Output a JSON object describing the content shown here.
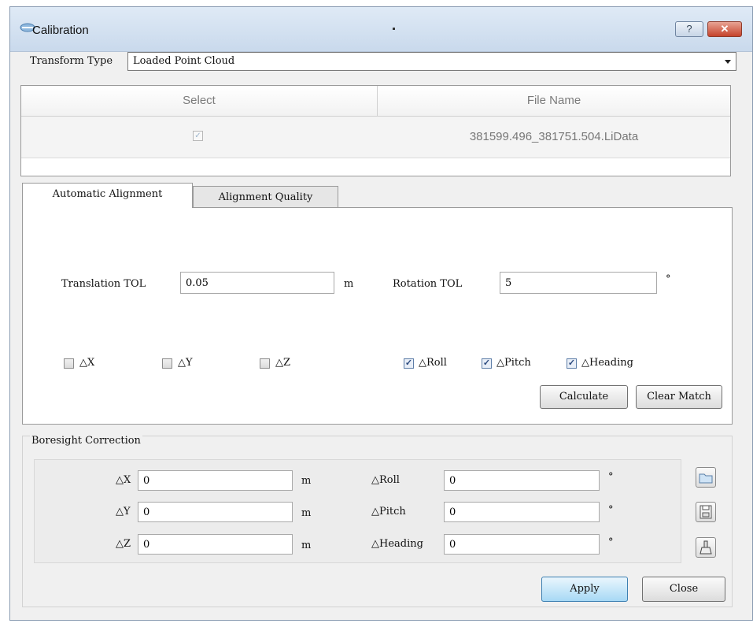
{
  "window": {
    "title": "Calibration",
    "help_label": "?",
    "close_label": "✕"
  },
  "transform": {
    "label": "Transform Type",
    "value": "Loaded Point Cloud"
  },
  "file_table": {
    "headers": [
      "Select",
      "File Name"
    ],
    "rows": [
      {
        "selected": true,
        "file_name": "381599.496_381751.504.LiData"
      }
    ]
  },
  "tabs": [
    {
      "label": "Automatic Alignment",
      "active": true
    },
    {
      "label": "Alignment Quality",
      "active": false
    }
  ],
  "alignment": {
    "translation_label": "Translation TOL",
    "translation_value": "0.05",
    "translation_unit": "m",
    "rotation_label": "Rotation TOL",
    "rotation_value": "5",
    "rotation_unit": "°",
    "checks": [
      {
        "label": "△X",
        "checked": false
      },
      {
        "label": "△Y",
        "checked": false
      },
      {
        "label": "△Z",
        "checked": false
      },
      {
        "label": "△Roll",
        "checked": true
      },
      {
        "label": "△Pitch",
        "checked": true
      },
      {
        "label": "△Heading",
        "checked": true
      }
    ],
    "calculate_label": "Calculate",
    "clear_label": "Clear Match"
  },
  "boresight": {
    "legend": "Boresight Correction",
    "fields": [
      {
        "label": "△X",
        "value": "0",
        "unit": "m"
      },
      {
        "label": "△Y",
        "value": "0",
        "unit": "m"
      },
      {
        "label": "△Z",
        "value": "0",
        "unit": "m"
      },
      {
        "label": "△Roll",
        "value": "0",
        "unit": "°"
      },
      {
        "label": "△Pitch",
        "value": "0",
        "unit": "°"
      },
      {
        "label": "△Heading",
        "value": "0",
        "unit": "°"
      }
    ],
    "icons": [
      "open-folder-icon",
      "save-icon",
      "clear-icon"
    ]
  },
  "footer": {
    "apply_label": "Apply",
    "close_label": "Close"
  }
}
